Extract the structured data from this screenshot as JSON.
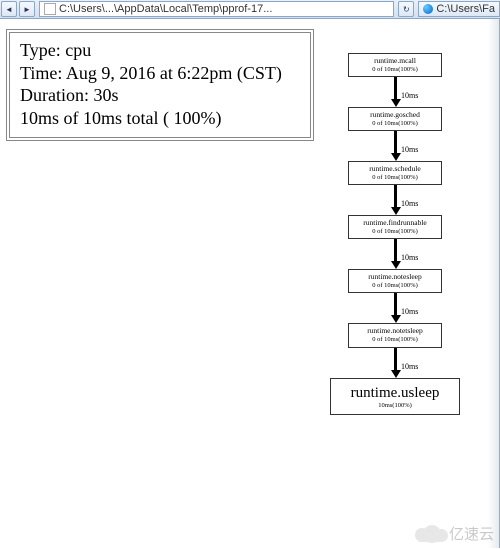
{
  "chrome": {
    "address": "C:\\Users\\...\\AppData\\Local\\Temp\\pprof-17...",
    "tab": "C:\\Users\\Fa"
  },
  "info": {
    "l1": "Type: cpu",
    "l2": "Time: Aug 9, 2016 at 6:22pm (CST)",
    "l3": "Duration: 30s",
    "l4": "10ms of 10ms total (   100%)"
  },
  "edge_label": "10ms",
  "nodes": [
    {
      "title": "runtime.mcall",
      "sub": "0 of 10ms(100%)"
    },
    {
      "title": "runtime.gosched",
      "sub": "0 of 10ms(100%)"
    },
    {
      "title": "runtime.schedule",
      "sub": "0 of 10ms(100%)"
    },
    {
      "title": "runtime.findrunnable",
      "sub": "0 of 10ms(100%)"
    },
    {
      "title": "runtime.notesleep",
      "sub": "0 of 10ms(100%)"
    },
    {
      "title": "runtime.notetsleep",
      "sub": "0 of 10ms(100%)"
    }
  ],
  "final_node": {
    "title": "runtime.usleep",
    "sub": "10ms(100%)"
  },
  "watermark": "亿速云"
}
